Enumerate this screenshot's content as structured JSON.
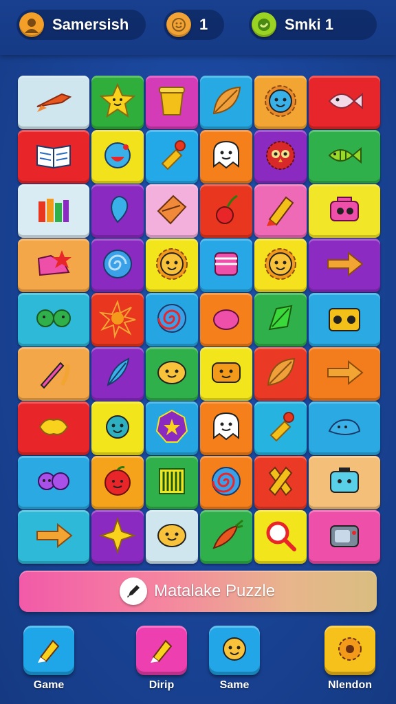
{
  "header": {
    "player_name": "Samersish",
    "coins": "1",
    "stage": "Smki 1"
  },
  "tile_colors": [
    [
      "#cfe6ee",
      "#2fae3c",
      "#d43bb6",
      "#27a9e3",
      "#f3a534",
      "#e6262a"
    ],
    [
      "#e8262a",
      "#f1e21c",
      "#24a9e8",
      "#f57f1a",
      "#8a2ac0",
      "#2fb04a"
    ],
    [
      "#d9ecf3",
      "#8a2ac0",
      "#f3b0dd",
      "#e8361f",
      "#ee6ab6",
      "#f2e628"
    ],
    [
      "#f4a748",
      "#8a2ac0",
      "#f3e51c",
      "#27a7e5",
      "#f6e11e",
      "#8b2bc2"
    ],
    [
      "#2fb9d8",
      "#e8361f",
      "#25a6e2",
      "#f57f1a",
      "#2fb04a",
      "#2aa9e2"
    ],
    [
      "#f4a748",
      "#8a2ac0",
      "#2fb04a",
      "#f3e51c",
      "#ea3a26",
      "#f37d1c"
    ],
    [
      "#e8262a",
      "#f3e51c",
      "#25a6e2",
      "#f57f1a",
      "#27b3e0",
      "#2aa9e2"
    ],
    [
      "#2aa9e2",
      "#f6a31c",
      "#2fb04a",
      "#f57f1a",
      "#ea3a26",
      "#f4c079"
    ],
    [
      "#2fb9d8",
      "#8a2ac0",
      "#cfe6ee",
      "#2fb04a",
      "#f3e51c",
      "#ee4fa8"
    ]
  ],
  "tile_icons": [
    [
      "rocket-icon",
      "star-face-icon",
      "bucket-icon",
      "leaf-icon",
      "gear-face-icon",
      "fish-icon"
    ],
    [
      "book-icon",
      "bubble-face-icon",
      "pin-icon",
      "ghost-face-icon",
      "owl-icon",
      "fish-bone-icon"
    ],
    [
      "bars-icon",
      "drop-icon",
      "envelope-icon",
      "cherry-icon",
      "pencil-icon",
      "camera-icon"
    ],
    [
      "shoe-icon",
      "swirl-icon",
      "sun-face-icon",
      "cup-icon",
      "sun-face-icon",
      "arrow-right-icon"
    ],
    [
      "bowtie-face-icon",
      "starburst-icon",
      "spiral-icon",
      "egg-icon",
      "gem-icon",
      "radio-icon"
    ],
    [
      "paintbrush-icon",
      "feather-icon",
      "blob-face-icon",
      "box-face-icon",
      "leaf-icon",
      "arrow-right-icon"
    ],
    [
      "candy-icon",
      "planet-face-icon",
      "badge-star-icon",
      "ghost-face-icon",
      "pin-icon",
      "whale-icon"
    ],
    [
      "speech-bubble-icon",
      "apple-face-icon",
      "barcode-icon",
      "spiral-icon",
      "x-mark-icon",
      "robot-face-icon"
    ],
    [
      "arrow-right-icon",
      "sparkle-star-icon",
      "blob-face-icon",
      "carrot-icon",
      "magnifier-icon",
      "tv-icon"
    ]
  ],
  "banner": {
    "title": "Matalake Puzzle",
    "icon": "pencil-icon"
  },
  "nav": [
    {
      "label": "Game",
      "icon": "pencil-icon",
      "color": "#1ea6e8"
    },
    {
      "label": "Dirip",
      "icon": "pencil-icon",
      "color": "#ee3fb0"
    },
    {
      "label": "Same",
      "icon": "face-icon",
      "color": "#22a6e8"
    },
    {
      "label": "Nlendon",
      "icon": "gear-icon",
      "color": "#f6c11a"
    }
  ]
}
